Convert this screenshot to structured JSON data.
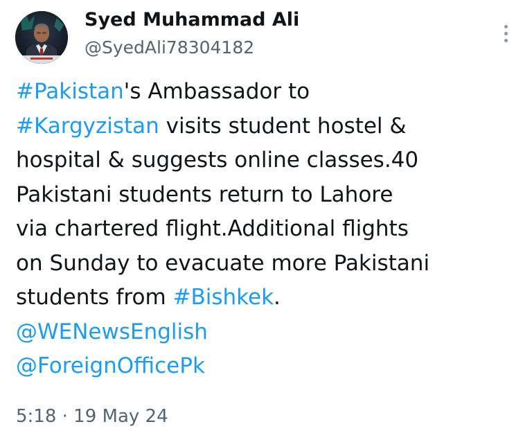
{
  "author": {
    "display_name": "Syed Muhammad Ali",
    "handle": "@SyedAli78304182",
    "avatar_icon": "profile-photo"
  },
  "menu": {
    "icon": "more-vertical-icon"
  },
  "tweet": {
    "segments": {
      "hashtag_pakistan": "#Pakistan",
      "text_1": "'s Ambassador to",
      "hashtag_kargyzistan": "#Kargyzistan",
      "text_2": " visits student hostel &",
      "text_3": "hospital & suggests online classes.40",
      "text_4": "Pakistani students return to Lahore",
      "text_5": "via chartered flight.Additional flights",
      "text_6": "on Sunday to evacuate more Pakistani",
      "text_7": "students from ",
      "hashtag_bishkek": "#Bishkek",
      "text_8": ".",
      "mention_wenews": "@WENewsEnglish",
      "mention_foreignoffice": "@ForeignOfficePk"
    }
  },
  "timestamp": "5:18 · 19 May 24",
  "colors": {
    "link": "#1d9bf0",
    "text": "#0f1419",
    "secondary": "#536471"
  }
}
